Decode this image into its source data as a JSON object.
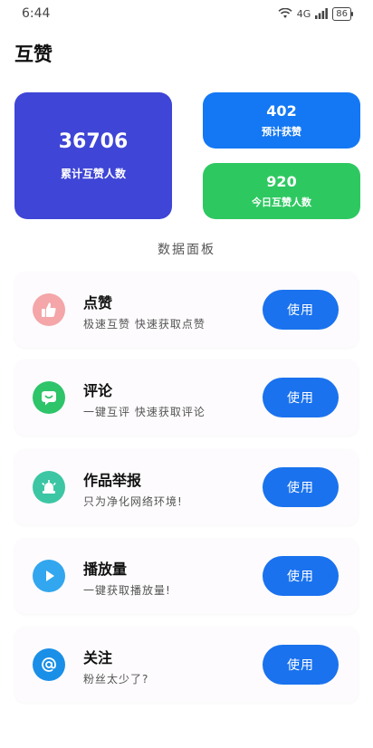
{
  "status_bar": {
    "time": "6:44",
    "network": "4G",
    "battery": "86"
  },
  "page": {
    "title": "互赞"
  },
  "stats": {
    "total": {
      "value": "36706",
      "label": "累计互赞人数"
    },
    "expected": {
      "value": "402",
      "label": "预计获赞"
    },
    "today": {
      "value": "920",
      "label": "今日互赞人数"
    }
  },
  "section": {
    "title": "数据面板"
  },
  "features": [
    {
      "name": "点赞",
      "desc": "极速互赞 快速获取点赞",
      "button": "使用",
      "icon": "thumbs-up-icon",
      "color": "#f4a6a8"
    },
    {
      "name": "评论",
      "desc": "一键互评 快速获取评论",
      "button": "使用",
      "icon": "comment-icon",
      "color": "#2ec46a"
    },
    {
      "name": "作品举报",
      "desc": "只为净化网络环境!",
      "button": "使用",
      "icon": "alarm-bell-icon",
      "color": "#3cc6a4"
    },
    {
      "name": "播放量",
      "desc": "一键获取播放量!",
      "button": "使用",
      "icon": "play-icon",
      "color": "#32a6ee"
    },
    {
      "name": "关注",
      "desc": "粉丝太少了?",
      "button": "使用",
      "icon": "at-sign-icon",
      "color": "#1a8fe8"
    }
  ]
}
